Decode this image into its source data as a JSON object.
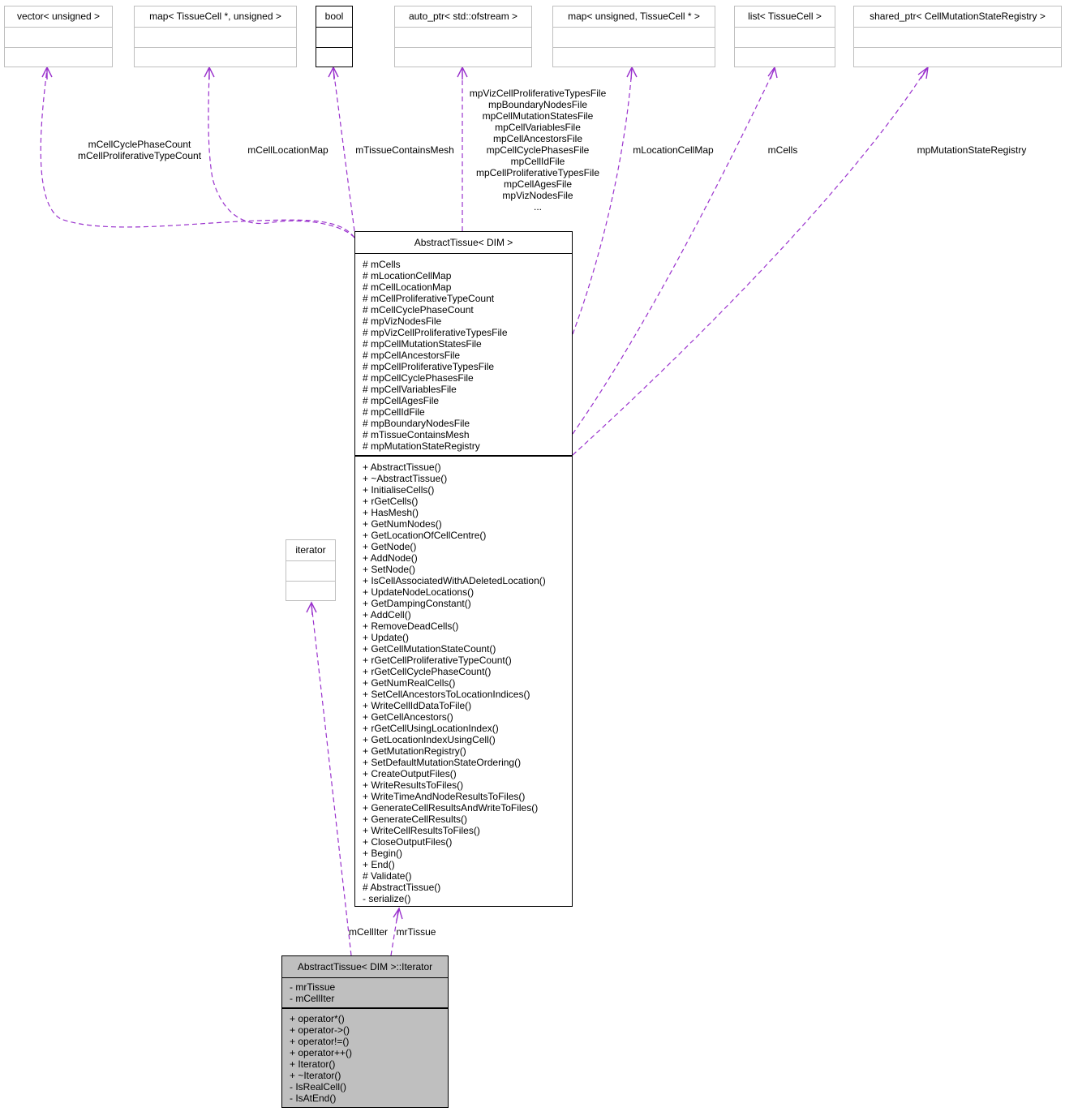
{
  "diagram": {
    "edge_color": "#9a32cd",
    "grey_border": "#bfbfbf",
    "filled_color": "#bfbfbf",
    "nodes": {
      "vector_unsigned": {
        "title": "vector< unsigned >"
      },
      "map_tissuecell_unsigned": {
        "title": "map< TissueCell *, unsigned >"
      },
      "bool": {
        "title": "bool"
      },
      "auto_ptr_ofstream": {
        "title": "auto_ptr< std::ofstream >"
      },
      "map_unsigned_tissuecell": {
        "title": "map< unsigned, TissueCell * >"
      },
      "list_tissuecell": {
        "title": "list< TissueCell >"
      },
      "shared_ptr_registry": {
        "title": "shared_ptr< CellMutationStateRegistry >"
      },
      "iterator": {
        "title": "iterator"
      },
      "abstract_tissue": {
        "title": "AbstractTissue< DIM >",
        "attributes": [
          "# mCells",
          "# mLocationCellMap",
          "# mCellLocationMap",
          "# mCellProliferativeTypeCount",
          "# mCellCyclePhaseCount",
          "# mpVizNodesFile",
          "# mpVizCellProliferativeTypesFile",
          "# mpCellMutationStatesFile",
          "# mpCellAncestorsFile",
          "# mpCellProliferativeTypesFile",
          "# mpCellCyclePhasesFile",
          "# mpCellVariablesFile",
          "# mpCellAgesFile",
          "# mpCellIdFile",
          "# mpBoundaryNodesFile",
          "# mTissueContainsMesh",
          "# mpMutationStateRegistry"
        ],
        "methods": [
          "+ AbstractTissue()",
          "+ ~AbstractTissue()",
          "+ InitialiseCells()",
          "+ rGetCells()",
          "+ HasMesh()",
          "+ GetNumNodes()",
          "+ GetLocationOfCellCentre()",
          "+ GetNode()",
          "+ AddNode()",
          "+ SetNode()",
          "+ IsCellAssociatedWithADeletedLocation()",
          "+ UpdateNodeLocations()",
          "+ GetDampingConstant()",
          "+ AddCell()",
          "+ RemoveDeadCells()",
          "+ Update()",
          "+ GetCellMutationStateCount()",
          "+ rGetCellProliferativeTypeCount()",
          "+ rGetCellCyclePhaseCount()",
          "+ GetNumRealCells()",
          "+ SetCellAncestorsToLocationIndices()",
          "+ WriteCellIdDataToFile()",
          "+ GetCellAncestors()",
          "+ rGetCellUsingLocationIndex()",
          "+ GetLocationIndexUsingCell()",
          "+ GetMutationRegistry()",
          "+ SetDefaultMutationStateOrdering()",
          "+ CreateOutputFiles()",
          "+ WriteResultsToFiles()",
          "+ WriteTimeAndNodeResultsToFiles()",
          "+ GenerateCellResultsAndWriteToFiles()",
          "+ GenerateCellResults()",
          "+ WriteCellResultsToFiles()",
          "+ CloseOutputFiles()",
          "+ Begin()",
          "+ End()",
          "# Validate()",
          "# AbstractTissue()",
          "- serialize()"
        ]
      },
      "iterator_class": {
        "title": "AbstractTissue< DIM >::Iterator",
        "attributes": [
          "- mrTissue",
          "- mCellIter"
        ],
        "methods": [
          "+ operator*()",
          "+ operator->()",
          "+ operator!=()",
          "+ operator++()",
          "+ Iterator()",
          "+ ~Iterator()",
          "- IsRealCell()",
          "- IsAtEnd()"
        ]
      }
    },
    "edge_labels": {
      "vector": [
        "mCellCyclePhaseCount",
        "mCellProliferativeTypeCount"
      ],
      "map_tc_u": [
        "mCellLocationMap"
      ],
      "bool": [
        "mTissueContainsMesh"
      ],
      "auto_ptr": [
        "mpVizCellProliferativeTypesFile",
        "mpBoundaryNodesFile",
        "mpCellMutationStatesFile",
        "mpCellVariablesFile",
        "mpCellAncestorsFile",
        "mpCellCyclePhasesFile",
        "mpCellIdFile",
        "mpCellProliferativeTypesFile",
        "mpCellAgesFile",
        "mpVizNodesFile",
        "..."
      ],
      "map_u_tc": [
        "mLocationCellMap"
      ],
      "list": [
        "mCells"
      ],
      "shared_ptr": [
        "mpMutationStateRegistry"
      ],
      "iterator": [
        "mCellIter"
      ],
      "tissue": [
        "mrTissue"
      ]
    }
  }
}
